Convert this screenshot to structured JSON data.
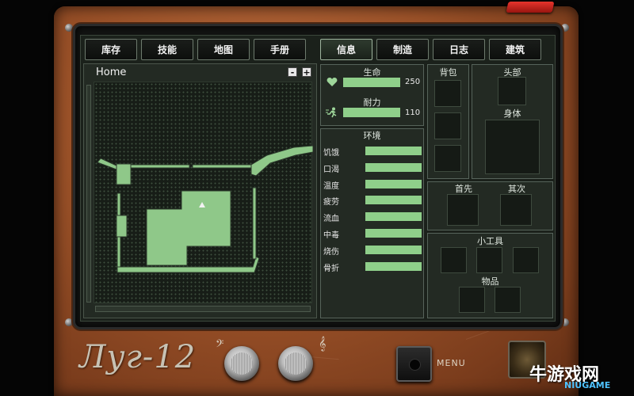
{
  "tabs_left": [
    "库存",
    "技能",
    "地图",
    "手册"
  ],
  "tabs_right": [
    "信息",
    "制造",
    "日志",
    "建筑"
  ],
  "map": {
    "title": "Home",
    "zoom_out": "-",
    "zoom_in": "+"
  },
  "vitals": {
    "health_label": "生命",
    "health_value": "250",
    "health_fill": 1.0,
    "stamina_label": "耐力",
    "stamina_value": "110",
    "stamina_fill": 1.0
  },
  "environment": {
    "title": "环境",
    "items": [
      {
        "label": "饥饿",
        "fill": 1.0
      },
      {
        "label": "口渴",
        "fill": 1.0
      },
      {
        "label": "温度",
        "fill": 1.0
      },
      {
        "label": "疲劳",
        "fill": 1.0
      },
      {
        "label": "流血",
        "fill": 1.0
      },
      {
        "label": "中毒",
        "fill": 1.0
      },
      {
        "label": "烧伤",
        "fill": 1.0
      },
      {
        "label": "骨折",
        "fill": 1.0
      }
    ]
  },
  "equipment": {
    "backpack": "背包",
    "head": "头部",
    "body": "身体",
    "primary": "首先",
    "secondary": "其次",
    "gadgets": "小工具",
    "items": "物品"
  },
  "device": {
    "brand": "Луг-12",
    "menu_label": "MENU"
  },
  "watermark": {
    "text": "牛游戏网",
    "sub": "NIUGAME"
  },
  "colors": {
    "bar": "#8fcf8a",
    "casing": "#9a5128",
    "screen": "#1b211b"
  }
}
